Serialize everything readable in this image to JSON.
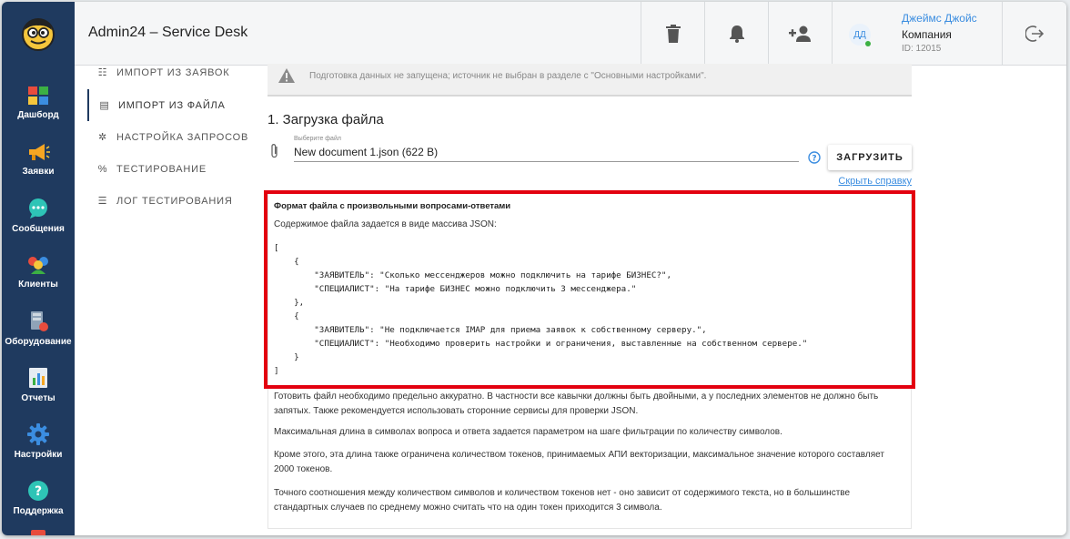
{
  "header": {
    "title": "Admin24 – Service Desk",
    "user": {
      "initials": "ДД",
      "name": "Джеймс Джойс",
      "company": "Компания",
      "id": "ID: 12015"
    }
  },
  "sidebar": {
    "items": [
      {
        "label": "Дашборд",
        "icon": "dashboard-icon"
      },
      {
        "label": "Заявки",
        "icon": "megaphone-icon"
      },
      {
        "label": "Сообщения",
        "icon": "chat-icon"
      },
      {
        "label": "Клиенты",
        "icon": "clients-icon"
      },
      {
        "label": "Оборудование",
        "icon": "equipment-icon"
      },
      {
        "label": "Отчеты",
        "icon": "reports-icon"
      },
      {
        "label": "Настройки",
        "icon": "gear-icon"
      },
      {
        "label": "Поддержка",
        "icon": "help-icon"
      }
    ]
  },
  "submenu": {
    "items": [
      {
        "label": "Импорт из заявок",
        "icon": "☷"
      },
      {
        "label": "Импорт из файла",
        "icon": "▤"
      },
      {
        "label": "Настройка запросов",
        "icon": "✲"
      },
      {
        "label": "Тестирование",
        "icon": "%"
      },
      {
        "label": "Лог тестирования",
        "icon": "☰"
      }
    ]
  },
  "main": {
    "alert": "Подготовка данных не запущена; источник не выбран в разделе с \"Основными настройками\".",
    "section_title": "1. Загрузка файла",
    "file_label": "Выберите файл",
    "file_value": "New document 1.json (622 B)",
    "upload_label": "ЗАГРУЗИТЬ",
    "hide_help": "Скрыть справку",
    "help": {
      "title": "Формат файла с произвольными вопросами-ответами",
      "subtitle": "Содержимое файла задается в виде массива JSON:",
      "code": "[\n    {\n        \"ЗАЯВИТЕЛЬ\": \"Сколько мессенджеров можно подключить на тарифе БИЗНЕС?\",\n        \"СПЕЦИАЛИСТ\": \"На тарифе БИЗНЕС можно подключить 3 мессенджера.\"\n    },\n    {\n        \"ЗАЯВИТЕЛЬ\": \"Не подключается IMAP для приема заявок к собственному серверу.\",\n        \"СПЕЦИАЛИСТ\": \"Необходимо проверить настройки и ограничения, выставленные на собственном сервере.\"\n    }\n]",
      "p1": "Готовить файл необходимо предельно аккуратно. В частности все кавычки должны быть двойными, а у последних элементов не должно быть запятых. Также рекомендуется использовать сторонние сервисы для проверки JSON.",
      "p2": "Максимальная длина в символах вопроса и ответа задается параметром на шаге фильтрации по количеству символов.",
      "p3": "Кроме этого, эта длина также ограничена количеством токенов, принимаемых АПИ векторизации, максимальное значение которого составляет 2000 токенов.",
      "p4": "Точного соотношения между количеством символов и количеством токенов нет - оно зависит от содержимого текста, но в большинстве стандартных случаев по среднему можно считать что на один токен приходится 3 символа."
    }
  },
  "colors": {
    "sidebar": "#1f3a5f",
    "accent": "#3b8de0",
    "highlight": "#e3000f"
  }
}
